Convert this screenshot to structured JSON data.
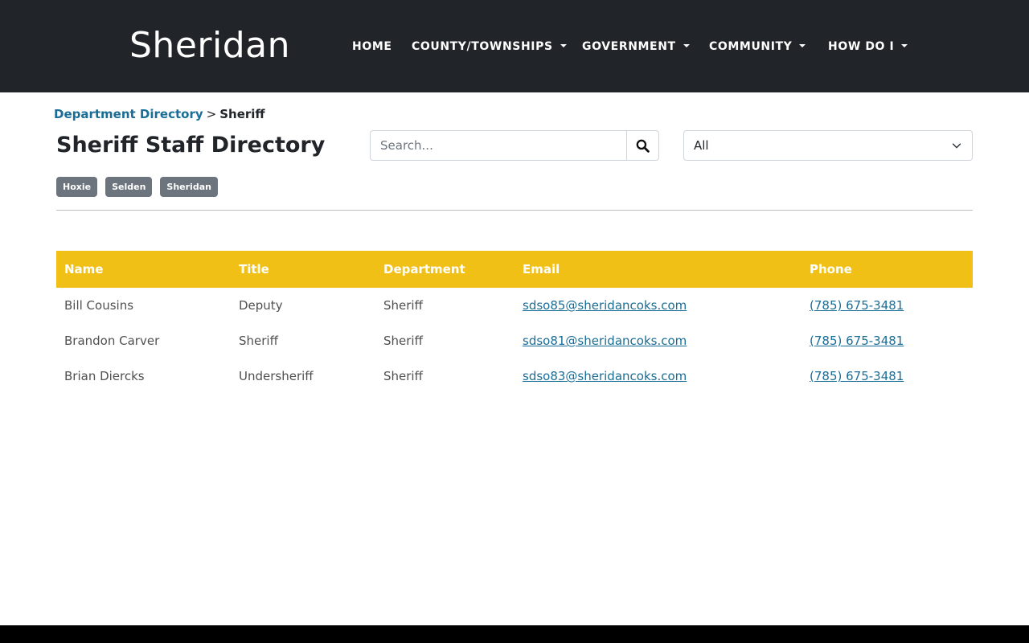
{
  "header": {
    "brand": "Sheridan",
    "nav": [
      {
        "label": "HOME",
        "dropdown": false
      },
      {
        "label": "COUNTY/TOWNSHIPS",
        "dropdown": true
      },
      {
        "label": "GOVERNMENT",
        "dropdown": true
      },
      {
        "label": "COMMUNITY",
        "dropdown": true
      },
      {
        "label": "HOW DO I",
        "dropdown": true
      }
    ]
  },
  "breadcrumb": {
    "parent": "Department Directory",
    "separator": ">",
    "current": "Sheriff"
  },
  "page": {
    "title": "Sheriff Staff Directory"
  },
  "search": {
    "placeholder": "Search...",
    "value": "",
    "icon": "search-icon"
  },
  "filter": {
    "selected": "All",
    "icon": "chevron-down-icon"
  },
  "tags": [
    "Hoxie",
    "Selden",
    "Sheridan"
  ],
  "table": {
    "columns": [
      "Name",
      "Title",
      "Department",
      "Email",
      "Phone"
    ],
    "rows": [
      {
        "name": "Bill Cousins",
        "title": "Deputy",
        "department": "Sheriff",
        "email": "sdso85@sheridancoks.com",
        "phone": "(785) 675-3481"
      },
      {
        "name": "Brandon Carver",
        "title": "Sheriff",
        "department": "Sheriff",
        "email": "sdso81@sheridancoks.com",
        "phone": "(785) 675-3481"
      },
      {
        "name": "Brian Diercks",
        "title": "Undersheriff",
        "department": "Sheriff",
        "email": "sdso83@sheridancoks.com",
        "phone": "(785) 675-3481"
      }
    ]
  },
  "colors": {
    "header_bg": "#212529",
    "table_header_bg": "#f1c017",
    "link": "#1a6d96",
    "tag_bg": "#6c757d"
  }
}
